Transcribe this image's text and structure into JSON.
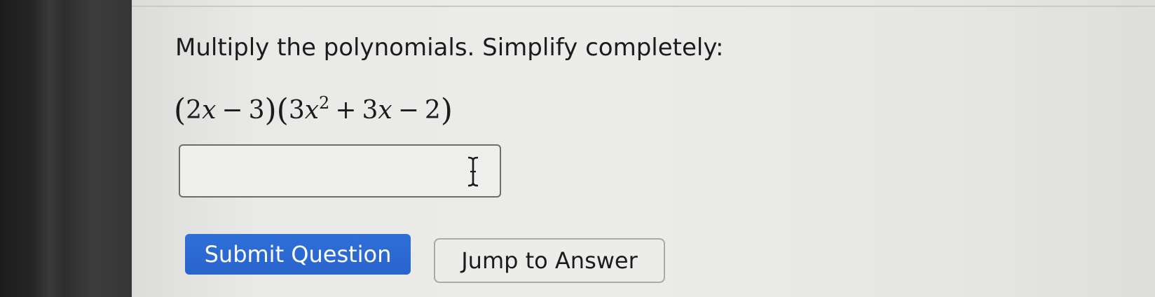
{
  "question": {
    "instruction": "Multiply the polynomials. Simplify completely:",
    "expression": {
      "f1_coef": "2",
      "f1_var": "x",
      "f1_op": "−",
      "f1_const": "3",
      "f2_coef1": "3",
      "f2_var1": "x",
      "f2_exp": "2",
      "f2_op1": "+",
      "f2_coef2": "3",
      "f2_var2": "x",
      "f2_op2": "−",
      "f2_const": "2"
    }
  },
  "answer": {
    "value": "",
    "placeholder": ""
  },
  "buttons": {
    "submit_label": "Submit Question",
    "jump_label": "Jump to Answer"
  },
  "colors": {
    "submit_bg": "#2a64cc",
    "page_bg": "#ececea",
    "text": "#1c1c1c"
  },
  "icons": {
    "cursor": "text-cursor-icon"
  }
}
